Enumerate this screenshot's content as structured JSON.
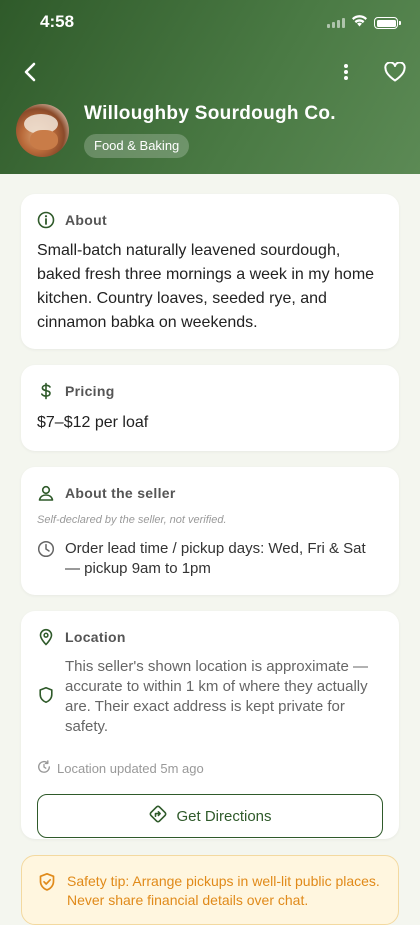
{
  "status": {
    "time": "4:58"
  },
  "seller": {
    "name": "Willoughby Sourdough Co.",
    "category": "Food & Baking"
  },
  "about": {
    "title": "About",
    "text": "Small-batch naturally leavened sourdough, baked fresh three mornings a week in my home kitchen. Country loaves, seeded rye, and cinnamon babka on weekends."
  },
  "pricing": {
    "title": "Pricing",
    "text": "$7–$12 per loaf"
  },
  "about_seller": {
    "title": "About the seller",
    "note": "Self-declared by the seller, not verified.",
    "lead_time": "Order lead time / pickup days: Wed, Fri & Sat — pickup 9am to 1pm"
  },
  "location": {
    "title": "Location",
    "privacy_text": "This seller's shown location is approximate — accurate to within 1 km of where they actually are. Their exact address is kept private for safety.",
    "updated": "Location updated 5m ago",
    "directions_label": "Get Directions"
  },
  "safety": {
    "text": "Safety tip: Arrange pickups in well-lit public places. Never share financial details over chat."
  },
  "colors": {
    "header_start": "#2f5a2a",
    "header_end": "#5c8a55",
    "accent_green": "#2f5a2a",
    "warning": "#e08a1a",
    "background": "#f4f6ef"
  },
  "icons": {
    "back": "chevron-left-icon",
    "more": "more-vertical-icon",
    "favorite": "heart-icon",
    "about": "info-icon",
    "pricing": "dollar-icon",
    "seller": "person-icon",
    "lead_time": "clock-icon",
    "location": "map-pin-icon",
    "privacy": "shield-icon",
    "updated": "refresh-clock-icon",
    "directions": "directions-icon",
    "safety": "shield-check-icon"
  }
}
